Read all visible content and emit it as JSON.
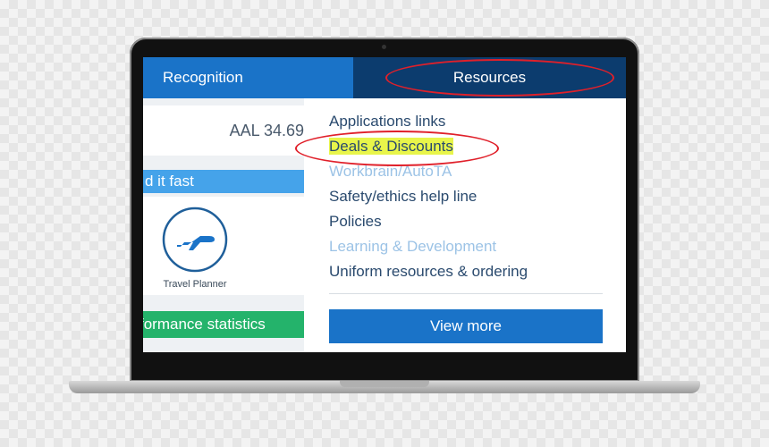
{
  "nav": {
    "recognition_label": "Recognition",
    "resources_label": "Resources"
  },
  "left_panel": {
    "stock_text": "AAL 34.69",
    "find_fast_label": "d it fast",
    "travel_label": "Travel Planner",
    "performance_label": "formance statistics"
  },
  "dropdown": {
    "items": [
      {
        "label": "Applications links",
        "style": "normal"
      },
      {
        "label": "Deals & Discounts",
        "style": "highlighted"
      },
      {
        "label": "Workbrain/AutoTA",
        "style": "faded"
      },
      {
        "label": "Safety/ethics help line",
        "style": "normal"
      },
      {
        "label": "Policies",
        "style": "normal"
      },
      {
        "label": "Learning & Development",
        "style": "faded"
      },
      {
        "label": "Uniform resources & ordering",
        "style": "normal"
      }
    ],
    "view_more_label": "View more"
  },
  "colors": {
    "recognition_tab": "#1a73c8",
    "resources_tab": "#0c3c6e",
    "annotation_oval": "#e0202a",
    "highlight": "#e8f54a",
    "find_fast_bar": "#45a3ea",
    "performance_bar": "#24b36b"
  },
  "icons": {
    "travel": "airplane-icon"
  }
}
